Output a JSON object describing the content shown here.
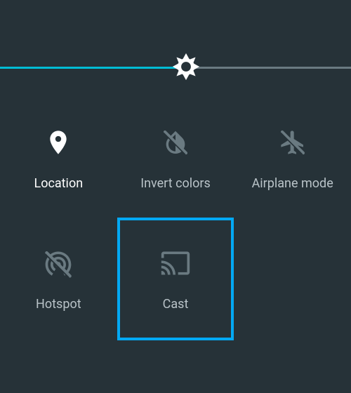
{
  "brightness": {
    "percent": 53
  },
  "colors": {
    "accent": "#00bcd4",
    "highlight": "#03a9f4",
    "bg": "#263238",
    "iconMuted": "#6a7a81",
    "iconActive": "#ffffff"
  },
  "tiles": {
    "location": {
      "label": "Location",
      "active": true
    },
    "invert": {
      "label": "Invert colors",
      "active": false
    },
    "airplane": {
      "label": "Airplane mode",
      "active": false
    },
    "hotspot": {
      "label": "Hotspot",
      "active": false
    },
    "cast": {
      "label": "Cast",
      "active": false,
      "highlighted": true
    }
  }
}
